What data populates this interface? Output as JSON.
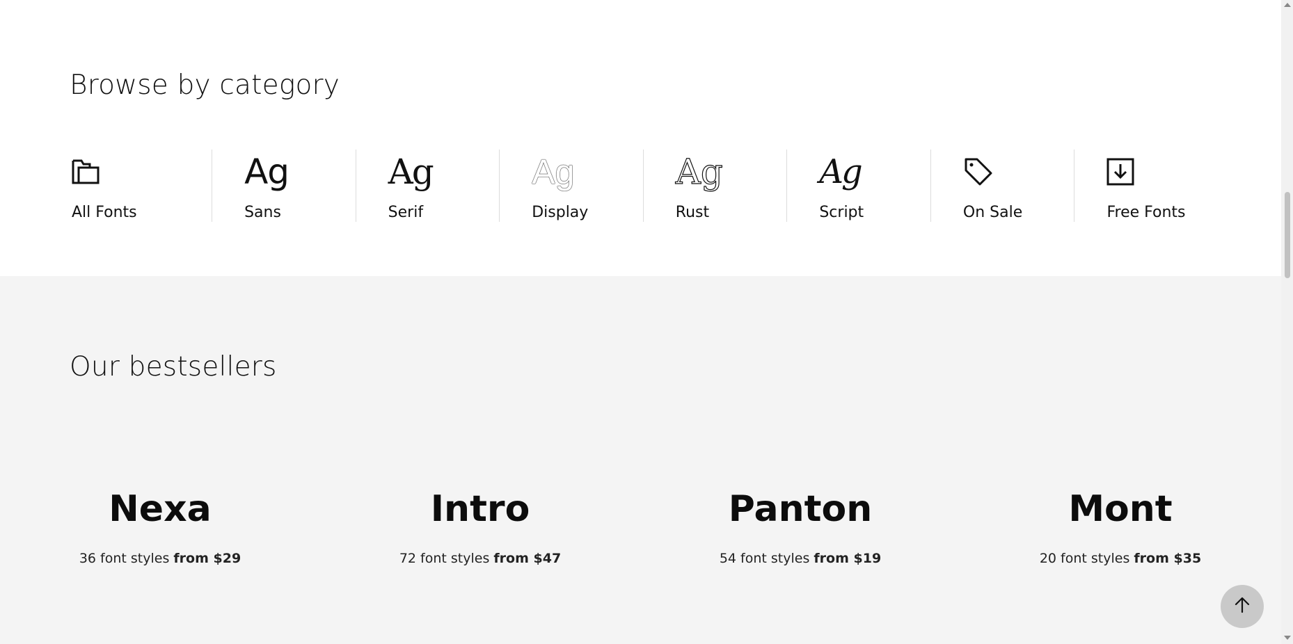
{
  "categories_section": {
    "title": "Browse by category",
    "items": [
      {
        "label": "All Fonts",
        "icon": "folder-icon"
      },
      {
        "label": "Sans",
        "glyph": "Ag"
      },
      {
        "label": "Serif",
        "glyph": "Ag"
      },
      {
        "label": "Display",
        "glyph": "Ag"
      },
      {
        "label": "Rust",
        "glyph": "Ag"
      },
      {
        "label": "Script",
        "glyph": "Ag"
      },
      {
        "label": "On Sale",
        "icon": "tag-icon"
      },
      {
        "label": "Free Fonts",
        "icon": "download-icon"
      }
    ]
  },
  "bestsellers_section": {
    "title": "Our bestsellers",
    "items": [
      {
        "name": "Nexa",
        "styles": "36 font styles",
        "price": "from $29"
      },
      {
        "name": "Intro",
        "styles": "72 font styles",
        "price": "from $47"
      },
      {
        "name": "Panton",
        "styles": "54 font styles",
        "price": "from $19"
      },
      {
        "name": "Mont",
        "styles": "20 font styles",
        "price": "from $35"
      }
    ]
  },
  "scroll_top_button": {
    "icon": "arrow-up-icon"
  },
  "colors": {
    "section_bg": "#f4f4f4",
    "button_bg": "#c9c9c9",
    "text": "#111111"
  }
}
